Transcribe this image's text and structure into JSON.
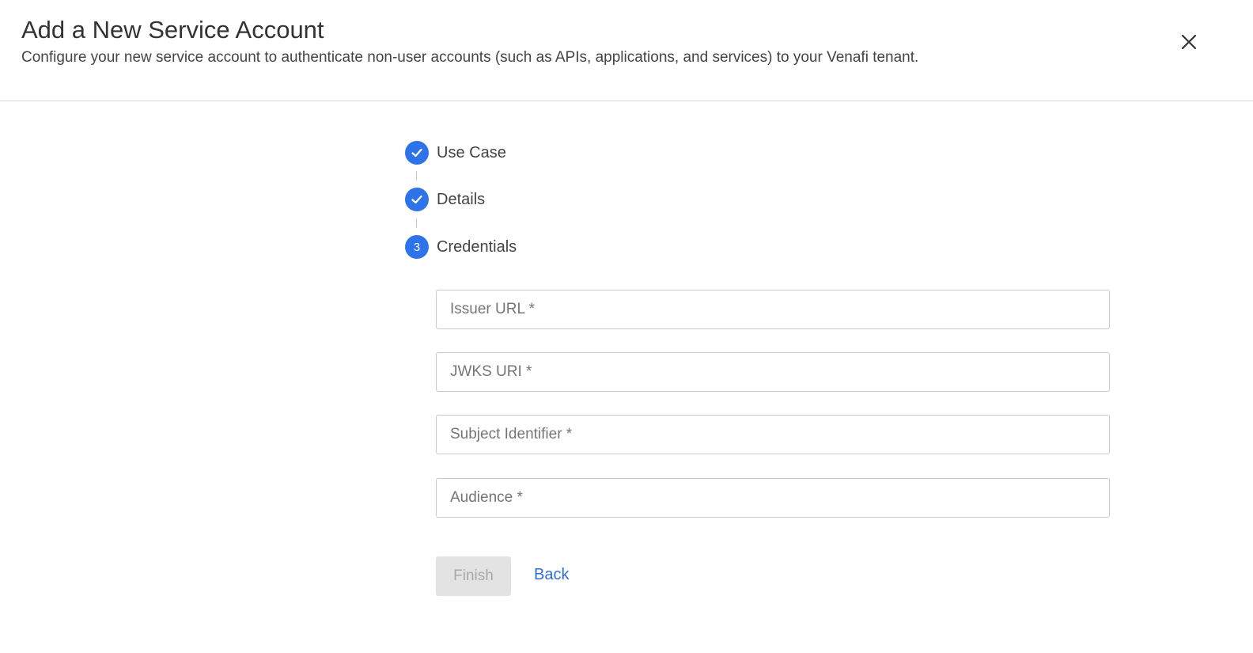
{
  "header": {
    "title": "Add a New Service Account",
    "subtitle": "Configure your new service account to authenticate non-user accounts (such as APIs, applications, and services) to your Venafi tenant.",
    "close_icon": "close-icon"
  },
  "stepper": {
    "steps": [
      {
        "label": "Use Case",
        "status": "completed",
        "icon": "check-icon"
      },
      {
        "label": "Details",
        "status": "completed",
        "icon": "check-icon"
      },
      {
        "label": "Credentials",
        "status": "active",
        "number": "3"
      }
    ]
  },
  "form": {
    "issuer_url": {
      "placeholder": "Issuer URL *",
      "value": ""
    },
    "jwks_uri": {
      "placeholder": "JWKS URI *",
      "value": ""
    },
    "subject_identifier": {
      "placeholder": "Subject Identifier *",
      "value": ""
    },
    "audience": {
      "placeholder": "Audience *",
      "value": ""
    }
  },
  "actions": {
    "finish_label": "Finish",
    "back_label": "Back"
  },
  "colors": {
    "accent": "#2f73ea",
    "link": "#2f6fd6",
    "disabled_bg": "#e3e3e3",
    "disabled_text": "#a9a9a9",
    "divider": "#d6d6d6"
  }
}
